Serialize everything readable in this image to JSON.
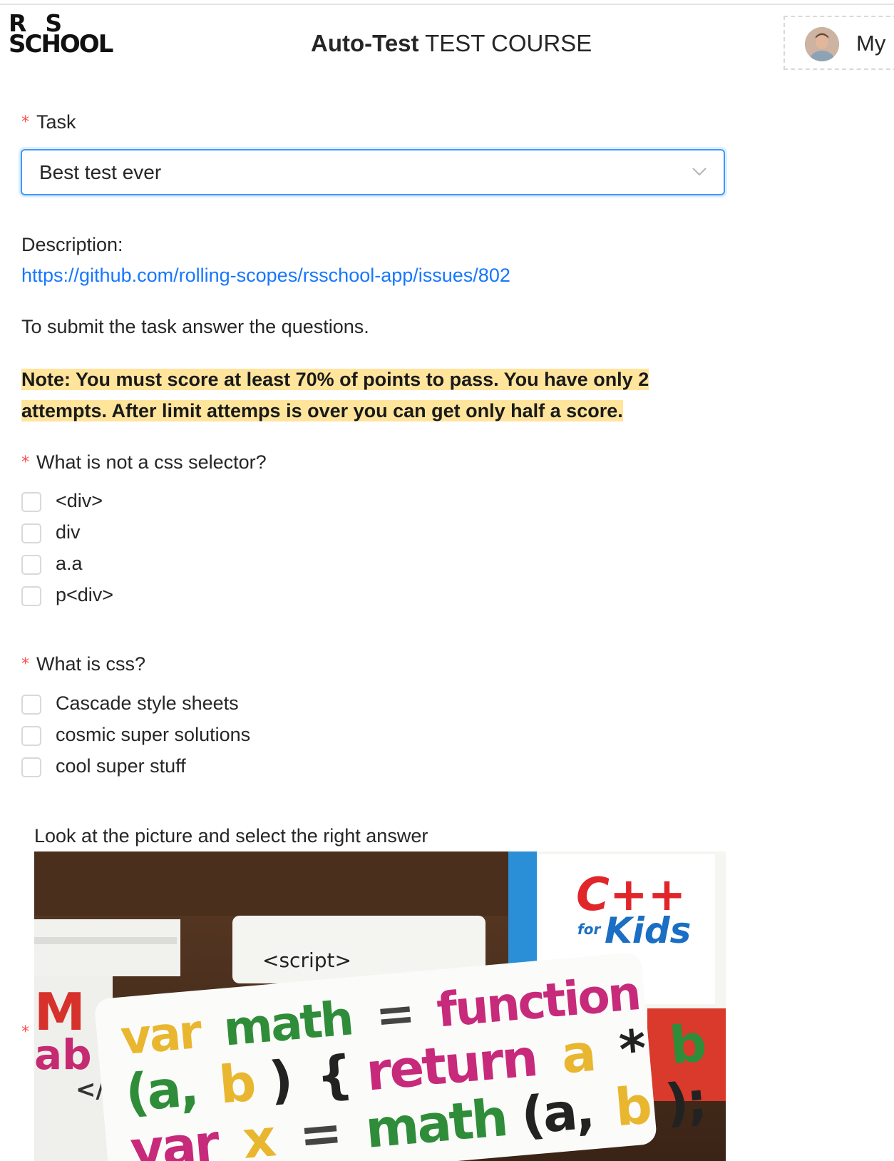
{
  "header": {
    "logo_line1_left": "R",
    "logo_line1_right": "S",
    "logo_line2": "SCHOOL",
    "title_bold": "Auto-Test",
    "title_rest": "TEST COURSE",
    "profile_label": "My"
  },
  "form": {
    "required_mark": "*",
    "task_label": "Task",
    "task_selected": "Best test ever",
    "description_label": "Description:",
    "description_link": "https://github.com/rolling-scopes/rsschool-app/issues/802",
    "intro": "To submit the task answer the questions.",
    "note": "Note: You must score at least 70% of points to pass. You have only 2 attempts. After limit attemps is over you can get only half a score."
  },
  "questions": [
    {
      "label": "What is not a css selector?",
      "options": [
        "<div>",
        "div",
        "a.a",
        "p<div>"
      ]
    },
    {
      "label": "What is css?",
      "options": [
        "Cascade style sheets",
        "cosmic super solutions",
        "cool super stuff"
      ]
    },
    {
      "label": "Look at the picture and select the right answer",
      "image_text": {
        "cpp_title": "C++",
        "cpp_for": "for",
        "cpp_kids": "Kids",
        "script_tag": "<script>",
        "line1_var": "var",
        "line1_math": "math",
        "line1_eq": "=",
        "line1_function": "function",
        "line2_paren_a": "(a,",
        "line2_b": "b",
        "line2_close": ")",
        "line2_brace": "{",
        "line2_return": "return",
        "line2_a": "a",
        "line2_star": "*",
        "line2_b2": "b",
        "line2_end": "}",
        "line3_var": "var",
        "line3_x": "x",
        "line3_eq": "=",
        "line3_math": "math",
        "line3_args_a": "(a,",
        "line3_args_b": "b",
        "line3_end": ");",
        "left_book_big": "M",
        "left_book_ab": "ab",
        "left_book_tag": "</"
      }
    }
  ]
}
